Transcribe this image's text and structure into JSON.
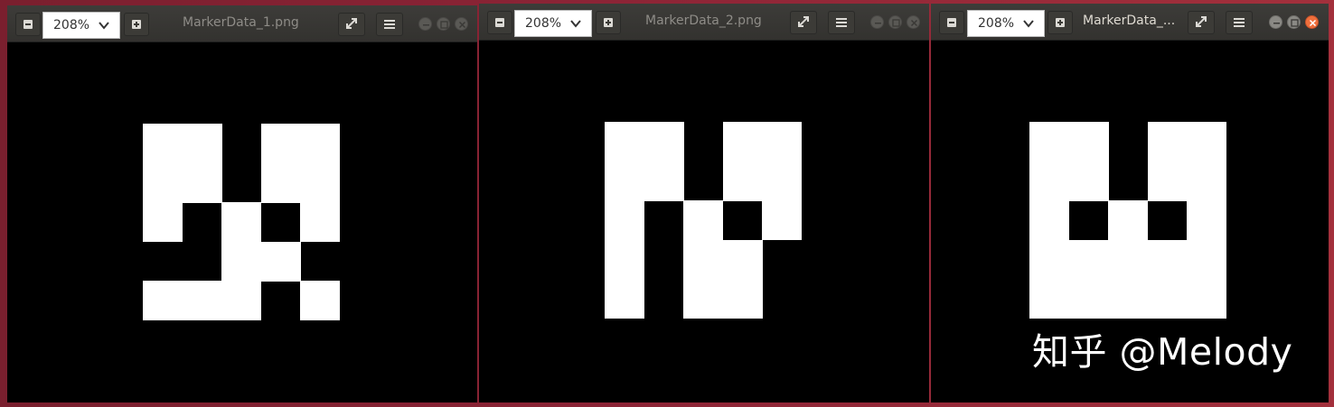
{
  "windows": [
    {
      "title": "MarkerData_1.png",
      "zoom": "208%",
      "active": false,
      "marker_cells": [
        [
          1,
          1,
          0,
          1,
          1
        ],
        [
          1,
          1,
          0,
          1,
          1
        ],
        [
          1,
          0,
          1,
          0,
          1
        ],
        [
          0,
          0,
          1,
          1,
          0
        ],
        [
          1,
          1,
          1,
          0,
          1
        ]
      ]
    },
    {
      "title": "MarkerData_2.png",
      "zoom": "208%",
      "active": false,
      "marker_cells": [
        [
          1,
          1,
          0,
          1,
          1
        ],
        [
          1,
          1,
          0,
          1,
          1
        ],
        [
          1,
          0,
          1,
          0,
          1
        ],
        [
          1,
          0,
          1,
          1,
          0
        ],
        [
          1,
          0,
          1,
          1,
          0
        ]
      ]
    },
    {
      "title": "MarkerData_...",
      "zoom": "208%",
      "active": true,
      "marker_cells": [
        [
          1,
          1,
          0,
          1,
          1
        ],
        [
          1,
          1,
          0,
          1,
          1
        ],
        [
          1,
          0,
          1,
          0,
          1
        ],
        [
          1,
          1,
          1,
          1,
          1
        ],
        [
          1,
          1,
          1,
          1,
          1
        ]
      ]
    }
  ],
  "icons": {
    "zoom_out": "minus-icon",
    "zoom_in": "plus-icon",
    "dropdown": "chevron-down-icon",
    "fullscreen": "fullscreen-icon",
    "menu": "hamburger-menu-icon",
    "minimize": "minimize-icon",
    "maximize": "maximize-icon",
    "close": "close-icon"
  },
  "watermark": "知乎 @Melody",
  "colors": {
    "titlebar": "#3d3c39",
    "close_active": "#ef6f3c",
    "desktop": "#8c2436"
  }
}
